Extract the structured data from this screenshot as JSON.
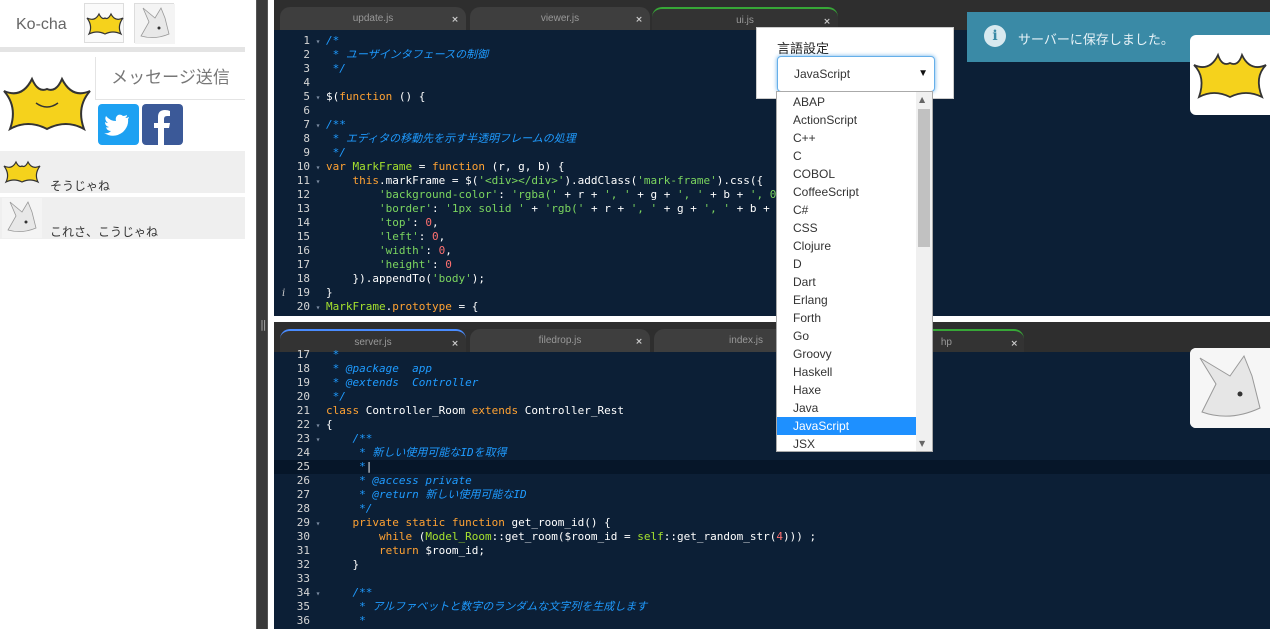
{
  "sidebar": {
    "brand": "Ko-cha",
    "message_button": "メッセージ送信",
    "comments": [
      {
        "text": "そうじゃね"
      },
      {
        "text": "これさ、こうじゃね"
      }
    ]
  },
  "editor_top": {
    "tabs": [
      {
        "label": "update.js"
      },
      {
        "label": "viewer.js"
      },
      {
        "label": "ui.js"
      }
    ],
    "lines": [
      {
        "n": "1",
        "f": "▾",
        "h": "<span class='c'>/*</span>"
      },
      {
        "n": "2",
        "f": "",
        "h": "<span class='c'> * ユーザインタフェースの制御</span>"
      },
      {
        "n": "3",
        "f": "",
        "h": "<span class='c'> */</span>"
      },
      {
        "n": "4",
        "f": "",
        "h": ""
      },
      {
        "n": "5",
        "f": "▾",
        "h": "$(<span class='k'>function</span> () {"
      },
      {
        "n": "6",
        "f": "",
        "h": ""
      },
      {
        "n": "7",
        "f": "▾",
        "h": "<span class='c'>/**</span>"
      },
      {
        "n": "8",
        "f": "",
        "h": "<span class='c'> * エディタの移動先を示す半透明フレームの処理</span>"
      },
      {
        "n": "9",
        "f": "",
        "h": "<span class='c'> */</span>"
      },
      {
        "n": "10",
        "f": "▾",
        "h": "<span class='k'>var</span> <span class='t'>MarkFrame</span> = <span class='k'>function</span> (r, g, b) {"
      },
      {
        "n": "11",
        "f": "▾",
        "h": "    <span class='k'>this</span>.markFrame = $(<span class='s'>'&lt;div&gt;&lt;/div&gt;'</span>).addClass(<span class='s'>'mark-frame'</span>).css({"
      },
      {
        "n": "12",
        "f": "",
        "h": "        <span class='s'>'background-color'</span>: <span class='s'>'rgba('</span> + r + <span class='s'>', '</span> + g + <span class='s'>', '</span> + b + <span class='s'>', 0</span>"
      },
      {
        "n": "13",
        "f": "",
        "h": "        <span class='s'>'border'</span>: <span class='s'>'1px solid '</span> + <span class='s'>'rgb('</span> + r + <span class='s'>', '</span> + g + <span class='s'>', '</span> + b + "
      },
      {
        "n": "14",
        "f": "",
        "h": "        <span class='s'>'top'</span>: <span class='n'>0</span>,"
      },
      {
        "n": "15",
        "f": "",
        "h": "        <span class='s'>'left'</span>: <span class='n'>0</span>,"
      },
      {
        "n": "16",
        "f": "",
        "h": "        <span class='s'>'width'</span>: <span class='n'>0</span>,"
      },
      {
        "n": "17",
        "f": "",
        "h": "        <span class='s'>'height'</span>: <span class='n'>0</span>"
      },
      {
        "n": "18",
        "f": "",
        "h": "    }).appendTo(<span class='s'>'body'</span>);"
      },
      {
        "n": "19",
        "f": "",
        "h": "}"
      },
      {
        "n": "20",
        "f": "▾",
        "h": "<span class='t'>MarkFrame</span>.<span class='k'>prototype</span> = {"
      }
    ]
  },
  "editor_bottom": {
    "tabs": [
      {
        "label": "server.js"
      },
      {
        "label": "filedrop.js"
      },
      {
        "label": "index.js"
      },
      {
        "label": "hp"
      }
    ],
    "lines": [
      {
        "n": "17",
        "f": "",
        "h": "<span class='c'> *</span>"
      },
      {
        "n": "18",
        "f": "",
        "h": "<span class='c'> * @package  app</span>"
      },
      {
        "n": "19",
        "f": "",
        "h": "<span class='c'> * @extends  Controller</span>"
      },
      {
        "n": "20",
        "f": "",
        "h": "<span class='c'> */</span>"
      },
      {
        "n": "21",
        "f": "",
        "h": "<span class='k'>class</span> Controller_Room <span class='k'>extends</span> Controller_Rest"
      },
      {
        "n": "22",
        "f": "▾",
        "h": "{"
      },
      {
        "n": "23",
        "f": "▾",
        "h": "    <span class='c'>/**</span>"
      },
      {
        "n": "24",
        "f": "",
        "h": "<span class='c'>     * 新しい使用可能なIDを取得</span>"
      },
      {
        "n": "25",
        "f": "",
        "h": "<span class='c'>     *</span><span class='src'>|</span>"
      },
      {
        "n": "26",
        "f": "",
        "h": "<span class='c'>     * @access private</span>"
      },
      {
        "n": "27",
        "f": "",
        "h": "<span class='c'>     * @return 新しい使用可能なID</span>"
      },
      {
        "n": "28",
        "f": "",
        "h": "<span class='c'>     */</span>"
      },
      {
        "n": "29",
        "f": "▾",
        "h": "    <span class='k'>private static function</span> get_room_id() {"
      },
      {
        "n": "30",
        "f": "",
        "h": "        <span class='k'>while</span> (<span class='t'>Model_Room</span>::get_room($room_id = <span class='t'>self</span>::get_random_str(<span class='n'>4</span>))) ;"
      },
      {
        "n": "31",
        "f": "",
        "h": "        <span class='k'>return</span> $room_id;"
      },
      {
        "n": "32",
        "f": "",
        "h": "    }"
      },
      {
        "n": "33",
        "f": "",
        "h": ""
      },
      {
        "n": "34",
        "f": "▾",
        "h": "    <span class='c'>/**</span>"
      },
      {
        "n": "35",
        "f": "",
        "h": "<span class='c'>     * アルファベットと数字のランダムな文字列を生成します</span>"
      },
      {
        "n": "36",
        "f": "",
        "h": "<span class='c'>     *</span>"
      }
    ]
  },
  "language": {
    "title": "言語設定",
    "selected": "JavaScript",
    "options": [
      "ABAP",
      "ActionScript",
      "C++",
      "C",
      "COBOL",
      "CoffeeScript",
      "C#",
      "CSS",
      "Clojure",
      "D",
      "Dart",
      "Erlang",
      "Forth",
      "Go",
      "Groovy",
      "Haskell",
      "Haxe",
      "Java",
      "JavaScript",
      "JSX"
    ]
  },
  "notification": {
    "message": "サーバーに保存しました。"
  },
  "colors": {
    "editor_bg": "#0c1f36",
    "comment": "#1f9bff",
    "keyword": "#ffa233",
    "string": "#7bd55f",
    "notify_bg": "#3a8aa6",
    "twitter": "#1da1f2",
    "facebook": "#3b5998"
  },
  "icons": {
    "info": "info-icon",
    "twitter": "twitter-icon",
    "facebook": "facebook-icon",
    "close": "close-icon"
  }
}
